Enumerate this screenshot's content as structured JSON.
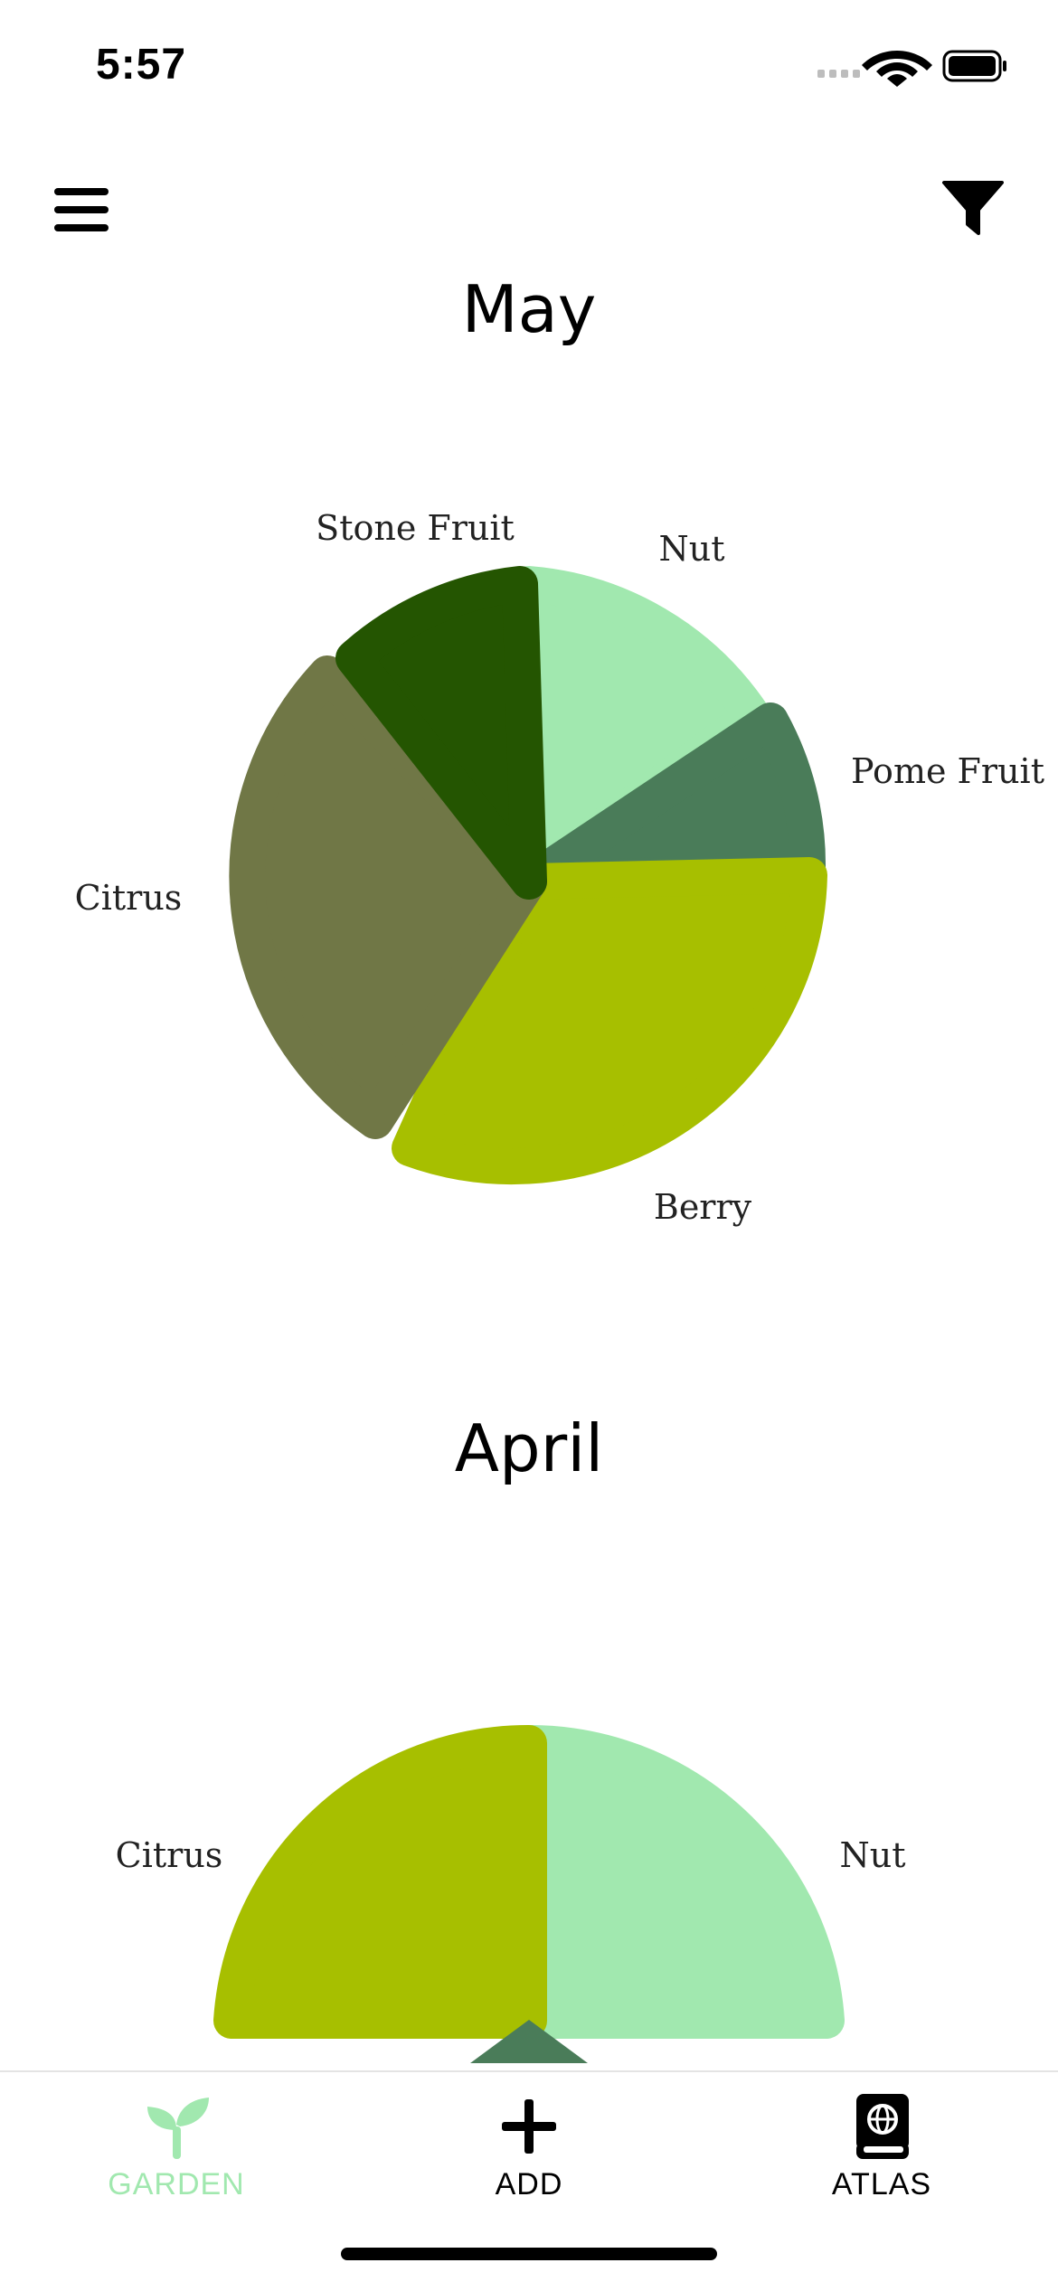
{
  "status_bar": {
    "time": "5:57"
  },
  "toolbar": {
    "menu_icon": "hamburger-menu-icon",
    "filter_icon": "filter-funnel-icon"
  },
  "charts": [
    {
      "month": "May",
      "slices": [
        {
          "label": "Nut",
          "color": "#a1e8af"
        },
        {
          "label": "Pome Fruit",
          "color": "#4a7c59"
        },
        {
          "label": "Berry",
          "color": "#a7bf00"
        },
        {
          "label": "Citrus",
          "color": "#707746"
        },
        {
          "label": "Stone Fruit",
          "color": "#245501"
        }
      ]
    },
    {
      "month": "April",
      "slices": [
        {
          "label": "Nut",
          "color": "#a1e8af"
        },
        {
          "label": "Citrus",
          "color": "#a7bf00"
        }
      ]
    }
  ],
  "tab_bar": {
    "tabs": [
      {
        "label": "GARDEN",
        "icon": "seedling-icon",
        "active": true,
        "color": "#a1e8af"
      },
      {
        "label": "ADD",
        "icon": "plus-icon",
        "active": false,
        "color": "#000000"
      },
      {
        "label": "ATLAS",
        "icon": "atlas-book-icon",
        "active": false,
        "color": "#000000"
      }
    ]
  }
}
